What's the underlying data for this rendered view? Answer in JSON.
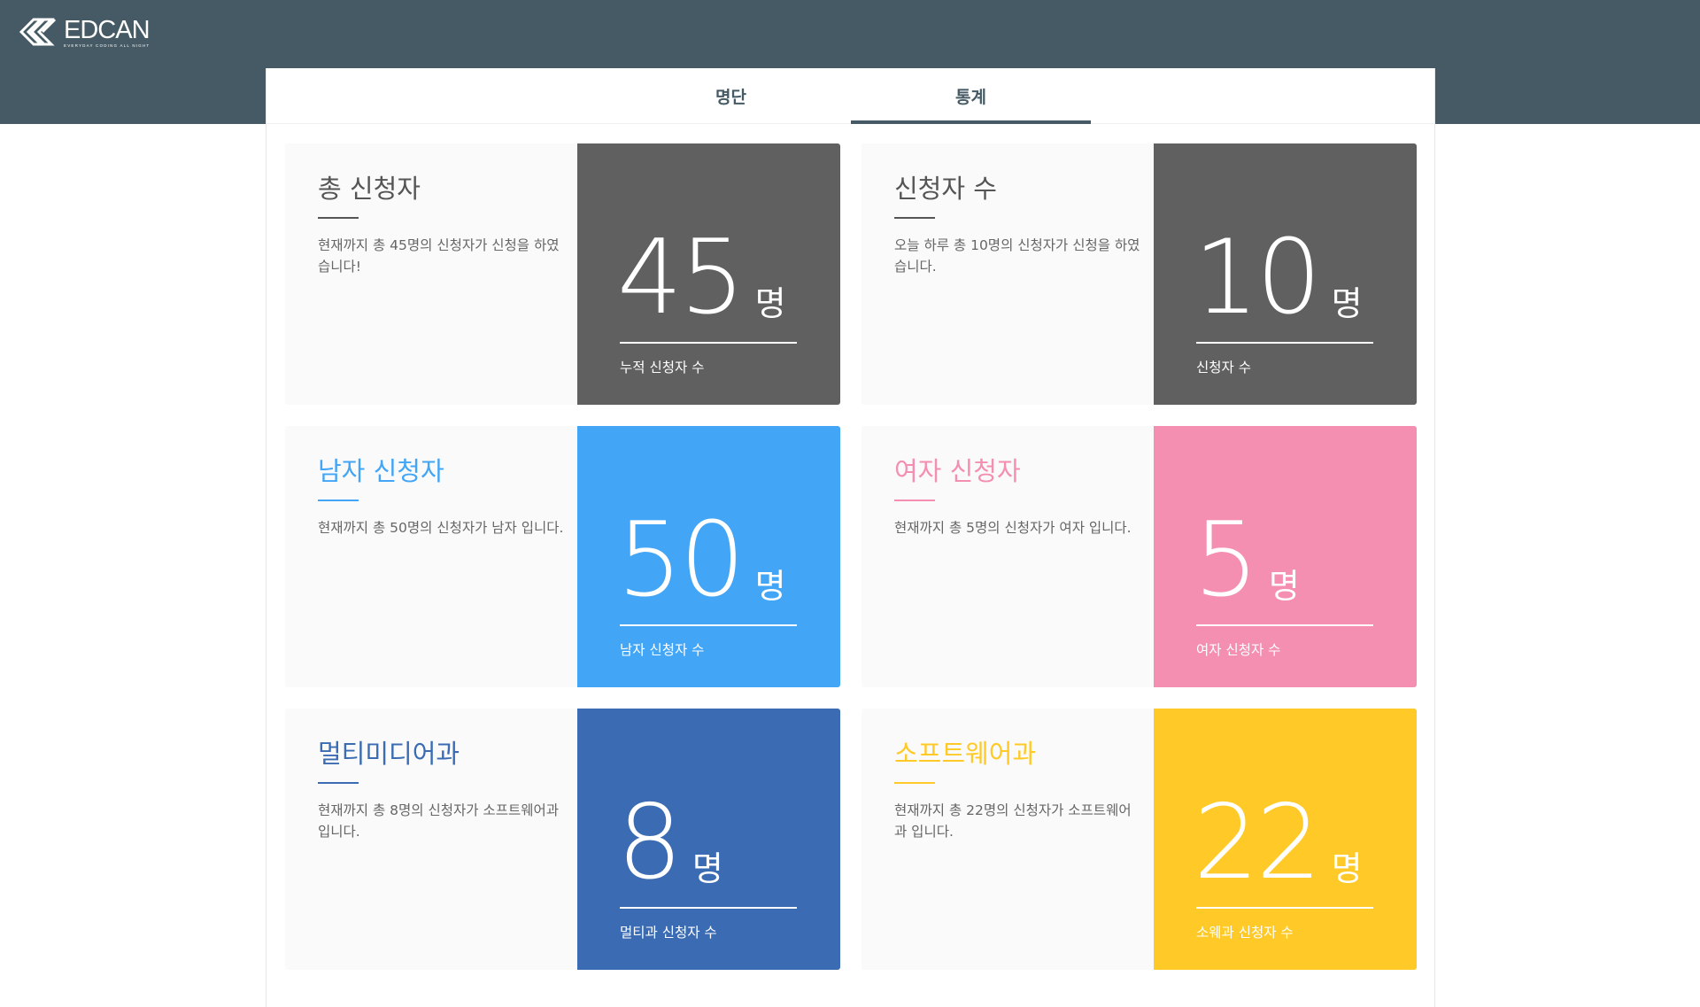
{
  "header": {
    "logo_text": "EDCAN",
    "logo_tagline": "EVERYDAY CODING ALL NIGHT",
    "background_color": "#455a64"
  },
  "tabs": [
    {
      "label": "명단",
      "active": false
    },
    {
      "label": "통계",
      "active": true
    }
  ],
  "cards": [
    {
      "title": "총 신청자",
      "description": "현재까지 총 45명의 신청자가 신청을 하였습니다!",
      "value": "45",
      "unit": "명",
      "caption": "누적 신청자 수",
      "color": "#606060"
    },
    {
      "title": "신청자 수",
      "description": "오늘 하루 총 10명의 신청자가 신청을 하였습니다.",
      "value": "10",
      "unit": "명",
      "caption": "신청자 수",
      "color": "#606060"
    },
    {
      "title": "남자 신청자",
      "description": "현재까지 총 50명의 신청자가 남자 입니다.",
      "value": "50",
      "unit": "명",
      "caption": "남자 신청자 수",
      "color": "#42a5f5"
    },
    {
      "title": "여자 신청자",
      "description": "현재까지 총 5명의 신청자가 여자 입니다.",
      "value": "5",
      "unit": "명",
      "caption": "여자 신청자 수",
      "color": "#f48fb1"
    },
    {
      "title": "멀티미디어과",
      "description": "현재까지 총 8명의 신청자가 소프트웨어과 입니다.",
      "value": "8",
      "unit": "명",
      "caption": "멀티과 신청자 수",
      "color": "#3b6cb3"
    },
    {
      "title": "소프트웨어과",
      "description": "현재까지 총 22명의 신청자가 소프트웨어과 입니다.",
      "value": "22",
      "unit": "명",
      "caption": "소웨과 신청자 수",
      "color": "#ffca28"
    }
  ]
}
